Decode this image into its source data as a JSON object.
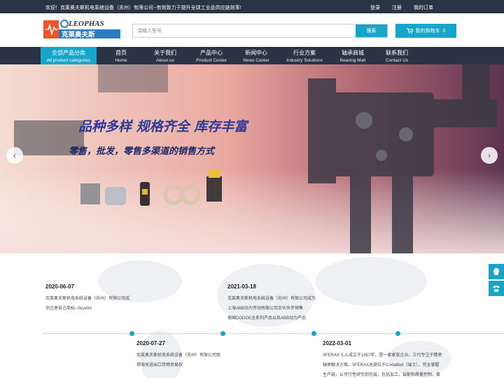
{
  "topbar": {
    "welcome": "欢迎！克莱奥夫斯机电系统设备（苏州）有限公司--有效致力于提升全球工业品供应链效率!",
    "login": "登录",
    "register": "注册",
    "orders": "我的订单"
  },
  "header": {
    "logo_en": "LEOPHAS",
    "logo_zh": "克莱奥夫斯",
    "search_placeholder": "请输入型号",
    "search_button": "搜索",
    "cart_label": "我的购物车",
    "cart_count": "0"
  },
  "nav": {
    "category_zh": "全部产品分类",
    "category_en": "All product categories",
    "items": [
      {
        "zh": "首页",
        "en": "Home"
      },
      {
        "zh": "关于我们",
        "en": "About us"
      },
      {
        "zh": "产品中心",
        "en": "Product Center"
      },
      {
        "zh": "新闻中心",
        "en": "News Center"
      },
      {
        "zh": "行业方案",
        "en": "Industry Solutions"
      },
      {
        "zh": "轴承商城",
        "en": "Bearing Mall"
      },
      {
        "zh": "联系我们",
        "en": "Contact Us"
      }
    ]
  },
  "banner": {
    "headline": "品种多样  规格齐全  库存丰富",
    "subline": "零售，批发，零售多渠道的销售方式"
  },
  "timeline": [
    {
      "date": "2020-06-07",
      "lines": [
        "克莱奥夫斯机电系统设备（苏州）有限公司成",
        "功注册自己商标--Skyefor"
      ]
    },
    {
      "date": "2021-03-18",
      "lines": [
        "克莱奥夫斯机电系统设备（苏州）有限公司成为",
        "上海ABB动力传动有限公司合伙伙伴销售",
        "美国DODGE全系列产品以及ABB动力产品"
      ]
    },
    {
      "date": "2020-07-27",
      "lines": [
        "克莱奥夫斯机电系统设备（苏州）有限公司取",
        "得海关进出口货物贸易权"
      ]
    },
    {
      "date": "2022-03-01",
      "lines": [
        "SFERAX S.A.成立于1957年，是一家家族企业，三代专注于精密",
        "轴承解决方案。SFERAX总部位于Cortaillod（瑞士），完全掌握",
        "生产链，从可行性研究到包装，包括加工，装配和质量控制。套"
      ]
    }
  ],
  "colors": {
    "accent": "#17a5c9",
    "dark": "#2b3444"
  }
}
